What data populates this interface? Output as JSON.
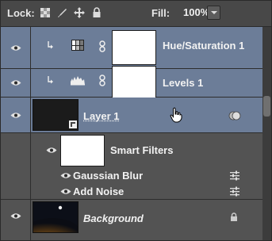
{
  "toolbar": {
    "lock_label": "Lock:",
    "fill_label": "Fill:",
    "fill_value": "100%"
  },
  "layers": {
    "hue_saturation": {
      "name": "Hue/Saturation 1"
    },
    "levels": {
      "name": "Levels 1"
    },
    "layer1": {
      "name": "Layer 1"
    },
    "smart_filters": {
      "name": "Smart Filters"
    },
    "gaussian_blur": {
      "name": "Gaussian Blur"
    },
    "add_noise": {
      "name": "Add Noise"
    },
    "background": {
      "name": "Background"
    }
  },
  "colors": {
    "selected_row": "#6c7d98",
    "panel": "#535353"
  }
}
